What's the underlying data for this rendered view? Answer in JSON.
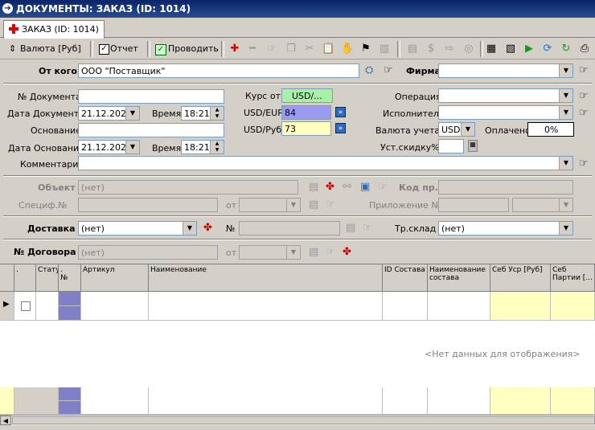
{
  "window": {
    "title": "ДОКУМЕНТЫ: ЗАКАЗ (ID: 1014)"
  },
  "tab": {
    "label": "ЗАКАЗ (ID: 1014)"
  },
  "toolbar": {
    "currency_btn": "Валюта [Руб]",
    "report_btn": "Отчет",
    "post_btn": "Проводить"
  },
  "from": {
    "label": "От кого",
    "value": "ООО \"Поставщик\""
  },
  "firm": {
    "label": "Фирма",
    "value": ""
  },
  "doc_no": {
    "label": "№ Документа",
    "value": ""
  },
  "doc_date": {
    "label": "Дата Документа",
    "value": "21.12.2021"
  },
  "time1": {
    "label": "Время",
    "value": "18:21"
  },
  "basis": {
    "label": "Основание",
    "value": ""
  },
  "basis_date": {
    "label": "Дата Основания",
    "value": "21.12.2021"
  },
  "time2": {
    "label": "Время",
    "value": "18:21"
  },
  "rate_from": {
    "label": "Курс от",
    "value": "USD/..."
  },
  "usd_eur": {
    "label": "USD/EUR",
    "value": "84"
  },
  "usd_rub": {
    "label": "USD/Руб",
    "value": "73"
  },
  "operation": {
    "label": "Операция",
    "value": ""
  },
  "executor": {
    "label": "Исполнитель",
    "value": ""
  },
  "acc_currency": {
    "label": "Валюта учета",
    "value": "USD"
  },
  "paid": {
    "label": "Оплачено",
    "value": "0%"
  },
  "discount": {
    "label": "Уст.скидку%",
    "value": ""
  },
  "comment": {
    "label": "Комментарий",
    "value": ""
  },
  "object": {
    "label": "Объект",
    "value": "(нет)",
    "code_label": "Код пр.",
    "spec_label": "Специф.№",
    "from_label": "от",
    "app_label": "Приложение №"
  },
  "delivery": {
    "label": "Доставка",
    "value": "(нет)",
    "no_label": "№",
    "tr_label": "Тр.склад",
    "tr_value": "(нет)"
  },
  "contract": {
    "label": "№ Договора",
    "value": "(нет)",
    "from_label": "от"
  },
  "grid": {
    "columns": [
      ".",
      "Статус",
      ".",
      "№",
      "Артикул",
      "Наименование",
      "ID Состава",
      "Наименование состава",
      "Себ Уср [Руб]",
      "Себ Партии [..."
    ],
    "empty_text": "<Нет данных для отображения>"
  },
  "colors": {
    "title_bg": "#0a246a",
    "rate_green": "#a8f0a8",
    "eur_bg": "#9b9bf0",
    "rub_bg": "#ffffc0",
    "accent_col": "#8080c8"
  }
}
